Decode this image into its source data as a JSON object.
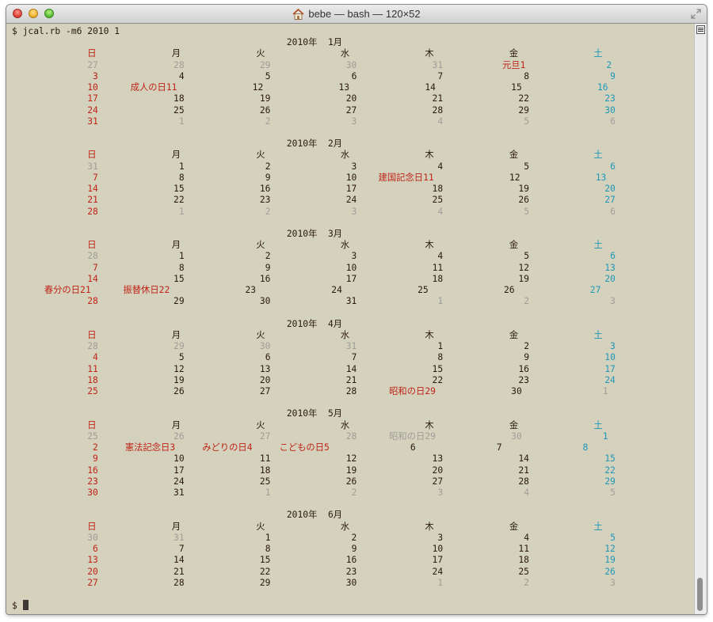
{
  "window": {
    "title": "bebe — bash — 120×52",
    "title_icon": "home-icon",
    "buttons": [
      "close",
      "minimize",
      "zoom"
    ]
  },
  "colors": {
    "background": "#d4d1bd",
    "text": "#2a1a0a",
    "sunday_holiday": "#c02418",
    "saturday": "#1f97b8",
    "other_month": "#a09e98"
  },
  "terminal": {
    "command": "$ jcal.rb -m6 2010 1",
    "prompt": "$ ",
    "weekday_headers": [
      "日",
      "月",
      "火",
      "水",
      "木",
      "金",
      "土"
    ],
    "months": [
      {
        "title": "2010年  1月",
        "weeks": [
          [
            {
              "d": "27",
              "t": "g"
            },
            {
              "d": "28",
              "t": "g"
            },
            {
              "d": "29",
              "t": "g"
            },
            {
              "d": "30",
              "t": "g"
            },
            {
              "d": "31",
              "t": "g"
            },
            {
              "d": "1",
              "t": "h",
              "label": "元旦"
            },
            {
              "d": "2",
              "t": "s"
            }
          ],
          [
            {
              "d": "3",
              "t": "h"
            },
            {
              "d": "4"
            },
            {
              "d": "5"
            },
            {
              "d": "6"
            },
            {
              "d": "7"
            },
            {
              "d": "8"
            },
            {
              "d": "9",
              "t": "s"
            }
          ],
          [
            {
              "d": "10",
              "t": "h"
            },
            {
              "d": "11",
              "t": "h",
              "label": "成人の日"
            },
            {
              "d": "12"
            },
            {
              "d": "13"
            },
            {
              "d": "14"
            },
            {
              "d": "15"
            },
            {
              "d": "16",
              "t": "s"
            }
          ],
          [
            {
              "d": "17",
              "t": "h"
            },
            {
              "d": "18"
            },
            {
              "d": "19"
            },
            {
              "d": "20"
            },
            {
              "d": "21"
            },
            {
              "d": "22"
            },
            {
              "d": "23",
              "t": "s"
            }
          ],
          [
            {
              "d": "24",
              "t": "h"
            },
            {
              "d": "25"
            },
            {
              "d": "26"
            },
            {
              "d": "27"
            },
            {
              "d": "28"
            },
            {
              "d": "29"
            },
            {
              "d": "30",
              "t": "s"
            }
          ],
          [
            {
              "d": "31",
              "t": "h"
            },
            {
              "d": "1",
              "t": "g"
            },
            {
              "d": "2",
              "t": "g"
            },
            {
              "d": "3",
              "t": "g"
            },
            {
              "d": "4",
              "t": "g"
            },
            {
              "d": "5",
              "t": "g"
            },
            {
              "d": "6",
              "t": "g"
            }
          ]
        ]
      },
      {
        "title": "2010年  2月",
        "weeks": [
          [
            {
              "d": "31",
              "t": "g"
            },
            {
              "d": "1"
            },
            {
              "d": "2"
            },
            {
              "d": "3"
            },
            {
              "d": "4"
            },
            {
              "d": "5"
            },
            {
              "d": "6",
              "t": "s"
            }
          ],
          [
            {
              "d": "7",
              "t": "h"
            },
            {
              "d": "8"
            },
            {
              "d": "9"
            },
            {
              "d": "10"
            },
            {
              "d": "11",
              "t": "h",
              "label": "建国記念日"
            },
            {
              "d": "12"
            },
            {
              "d": "13",
              "t": "s"
            }
          ],
          [
            {
              "d": "14",
              "t": "h"
            },
            {
              "d": "15"
            },
            {
              "d": "16"
            },
            {
              "d": "17"
            },
            {
              "d": "18"
            },
            {
              "d": "19"
            },
            {
              "d": "20",
              "t": "s"
            }
          ],
          [
            {
              "d": "21",
              "t": "h"
            },
            {
              "d": "22"
            },
            {
              "d": "23"
            },
            {
              "d": "24"
            },
            {
              "d": "25"
            },
            {
              "d": "26"
            },
            {
              "d": "27",
              "t": "s"
            }
          ],
          [
            {
              "d": "28",
              "t": "h"
            },
            {
              "d": "1",
              "t": "g"
            },
            {
              "d": "2",
              "t": "g"
            },
            {
              "d": "3",
              "t": "g"
            },
            {
              "d": "4",
              "t": "g"
            },
            {
              "d": "5",
              "t": "g"
            },
            {
              "d": "6",
              "t": "g"
            }
          ]
        ]
      },
      {
        "title": "2010年  3月",
        "weeks": [
          [
            {
              "d": "28",
              "t": "g"
            },
            {
              "d": "1"
            },
            {
              "d": "2"
            },
            {
              "d": "3"
            },
            {
              "d": "4"
            },
            {
              "d": "5"
            },
            {
              "d": "6",
              "t": "s"
            }
          ],
          [
            {
              "d": "7",
              "t": "h"
            },
            {
              "d": "8"
            },
            {
              "d": "9"
            },
            {
              "d": "10"
            },
            {
              "d": "11"
            },
            {
              "d": "12"
            },
            {
              "d": "13",
              "t": "s"
            }
          ],
          [
            {
              "d": "14",
              "t": "h"
            },
            {
              "d": "15"
            },
            {
              "d": "16"
            },
            {
              "d": "17"
            },
            {
              "d": "18"
            },
            {
              "d": "19"
            },
            {
              "d": "20",
              "t": "s"
            }
          ],
          [
            {
              "d": "21",
              "t": "h",
              "label": "春分の日"
            },
            {
              "d": "22",
              "t": "h",
              "label": "振替休日"
            },
            {
              "d": "23"
            },
            {
              "d": "24"
            },
            {
              "d": "25"
            },
            {
              "d": "26"
            },
            {
              "d": "27",
              "t": "s"
            }
          ],
          [
            {
              "d": "28",
              "t": "h"
            },
            {
              "d": "29"
            },
            {
              "d": "30"
            },
            {
              "d": "31"
            },
            {
              "d": "1",
              "t": "g"
            },
            {
              "d": "2",
              "t": "g"
            },
            {
              "d": "3",
              "t": "g"
            }
          ]
        ]
      },
      {
        "title": "2010年  4月",
        "weeks": [
          [
            {
              "d": "28",
              "t": "g"
            },
            {
              "d": "29",
              "t": "g"
            },
            {
              "d": "30",
              "t": "g"
            },
            {
              "d": "31",
              "t": "g"
            },
            {
              "d": "1"
            },
            {
              "d": "2"
            },
            {
              "d": "3",
              "t": "s"
            }
          ],
          [
            {
              "d": "4",
              "t": "h"
            },
            {
              "d": "5"
            },
            {
              "d": "6"
            },
            {
              "d": "7"
            },
            {
              "d": "8"
            },
            {
              "d": "9"
            },
            {
              "d": "10",
              "t": "s"
            }
          ],
          [
            {
              "d": "11",
              "t": "h"
            },
            {
              "d": "12"
            },
            {
              "d": "13"
            },
            {
              "d": "14"
            },
            {
              "d": "15"
            },
            {
              "d": "16"
            },
            {
              "d": "17",
              "t": "s"
            }
          ],
          [
            {
              "d": "18",
              "t": "h"
            },
            {
              "d": "19"
            },
            {
              "d": "20"
            },
            {
              "d": "21"
            },
            {
              "d": "22"
            },
            {
              "d": "23"
            },
            {
              "d": "24",
              "t": "s"
            }
          ],
          [
            {
              "d": "25",
              "t": "h"
            },
            {
              "d": "26"
            },
            {
              "d": "27"
            },
            {
              "d": "28"
            },
            {
              "d": "29",
              "t": "h",
              "label": "昭和の日"
            },
            {
              "d": "30"
            },
            {
              "d": "1",
              "t": "g"
            }
          ]
        ]
      },
      {
        "title": "2010年  5月",
        "weeks": [
          [
            {
              "d": "25",
              "t": "g"
            },
            {
              "d": "26",
              "t": "g"
            },
            {
              "d": "27",
              "t": "g"
            },
            {
              "d": "28",
              "t": "g"
            },
            {
              "d": "29",
              "t": "g",
              "label": "昭和の日"
            },
            {
              "d": "30",
              "t": "g"
            },
            {
              "d": "1",
              "t": "s"
            }
          ],
          [
            {
              "d": "2",
              "t": "h"
            },
            {
              "d": "3",
              "t": "h",
              "label": "憲法記念日"
            },
            {
              "d": "4",
              "t": "h",
              "label": "みどりの日"
            },
            {
              "d": "5",
              "t": "h",
              "label": "こどもの日"
            },
            {
              "d": "6"
            },
            {
              "d": "7"
            },
            {
              "d": "8",
              "t": "s"
            }
          ],
          [
            {
              "d": "9",
              "t": "h"
            },
            {
              "d": "10"
            },
            {
              "d": "11"
            },
            {
              "d": "12"
            },
            {
              "d": "13"
            },
            {
              "d": "14"
            },
            {
              "d": "15",
              "t": "s"
            }
          ],
          [
            {
              "d": "16",
              "t": "h"
            },
            {
              "d": "17"
            },
            {
              "d": "18"
            },
            {
              "d": "19"
            },
            {
              "d": "20"
            },
            {
              "d": "21"
            },
            {
              "d": "22",
              "t": "s"
            }
          ],
          [
            {
              "d": "23",
              "t": "h"
            },
            {
              "d": "24"
            },
            {
              "d": "25"
            },
            {
              "d": "26"
            },
            {
              "d": "27"
            },
            {
              "d": "28"
            },
            {
              "d": "29",
              "t": "s"
            }
          ],
          [
            {
              "d": "30",
              "t": "h"
            },
            {
              "d": "31"
            },
            {
              "d": "1",
              "t": "g"
            },
            {
              "d": "2",
              "t": "g"
            },
            {
              "d": "3",
              "t": "g"
            },
            {
              "d": "4",
              "t": "g"
            },
            {
              "d": "5",
              "t": "g"
            }
          ]
        ]
      },
      {
        "title": "2010年  6月",
        "weeks": [
          [
            {
              "d": "30",
              "t": "g"
            },
            {
              "d": "31",
              "t": "g"
            },
            {
              "d": "1"
            },
            {
              "d": "2"
            },
            {
              "d": "3"
            },
            {
              "d": "4"
            },
            {
              "d": "5",
              "t": "s"
            }
          ],
          [
            {
              "d": "6",
              "t": "h"
            },
            {
              "d": "7"
            },
            {
              "d": "8"
            },
            {
              "d": "9"
            },
            {
              "d": "10"
            },
            {
              "d": "11"
            },
            {
              "d": "12",
              "t": "s"
            }
          ],
          [
            {
              "d": "13",
              "t": "h"
            },
            {
              "d": "14"
            },
            {
              "d": "15"
            },
            {
              "d": "16"
            },
            {
              "d": "17"
            },
            {
              "d": "18"
            },
            {
              "d": "19",
              "t": "s"
            }
          ],
          [
            {
              "d": "20",
              "t": "h"
            },
            {
              "d": "21"
            },
            {
              "d": "22"
            },
            {
              "d": "23"
            },
            {
              "d": "24"
            },
            {
              "d": "25"
            },
            {
              "d": "26",
              "t": "s"
            }
          ],
          [
            {
              "d": "27",
              "t": "h"
            },
            {
              "d": "28"
            },
            {
              "d": "29"
            },
            {
              "d": "30"
            },
            {
              "d": "1",
              "t": "g"
            },
            {
              "d": "2",
              "t": "g"
            },
            {
              "d": "3",
              "t": "g"
            }
          ]
        ]
      }
    ]
  }
}
